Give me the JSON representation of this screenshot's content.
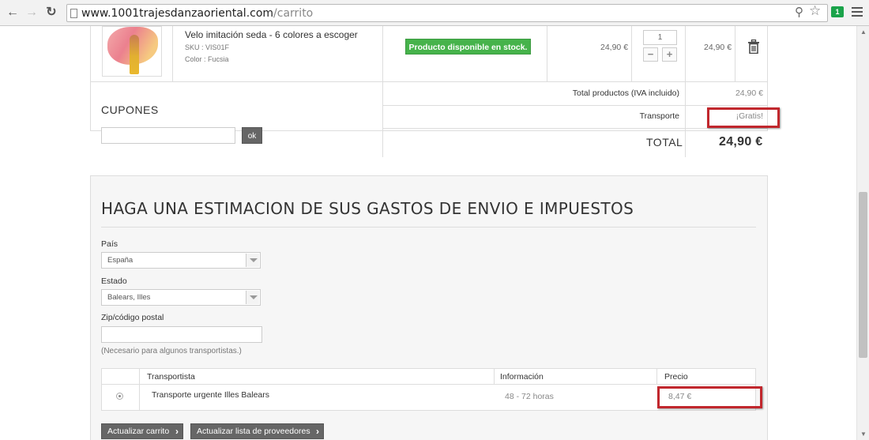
{
  "browser": {
    "url_host": "www.1001trajesdanzaoriental.com",
    "url_path": "/carrito",
    "back_icon": "back-arrow-icon",
    "forward_icon": "forward-arrow-icon",
    "reload_icon": "reload-icon",
    "extension_badge": "1"
  },
  "cart": {
    "product": {
      "name": "Velo imitación seda - 6 colores a escoger",
      "sku": "SKU : VIS01F",
      "color": "Color : Fucsia",
      "availability": "Producto disponible en stock.",
      "unit_price": "24,90 €",
      "quantity": "1",
      "qty_minus": "−",
      "qty_plus": "+",
      "line_total": "24,90 €"
    },
    "coupons": {
      "title": "CUPONES",
      "input_value": "",
      "ok_label": "ok"
    },
    "summary": {
      "products_label": "Total productos (IVA incluido)",
      "products_value": "24,90 €",
      "shipping_label": "Transporte",
      "shipping_value": "¡Gratis!",
      "total_label": "TOTAL",
      "total_value": "24,90 €"
    }
  },
  "estimator": {
    "title": "HAGA UNA ESTIMACION DE SUS GASTOS DE ENVIO E IMPUESTOS",
    "country_label": "País",
    "country_value": "España",
    "state_label": "Estado",
    "state_value": "Balears, Illes",
    "zip_label": "Zip/código postal",
    "zip_value": "",
    "hint": "(Necesario para algunos transportistas.)",
    "table": {
      "headers": [
        "Transportista",
        "Información",
        "Precio"
      ],
      "rows": [
        {
          "carrier": "Transporte urgente Illes Balears",
          "info": "48 - 72 horas",
          "price": "8,47 €"
        }
      ]
    },
    "buttons": {
      "update_cart": "Actualizar carrito",
      "update_carriers": "Actualizar lista de proveedores"
    }
  },
  "colors": {
    "stock_green": "#46b34b",
    "highlight_red": "#c1272d",
    "button_gray": "#666666"
  }
}
